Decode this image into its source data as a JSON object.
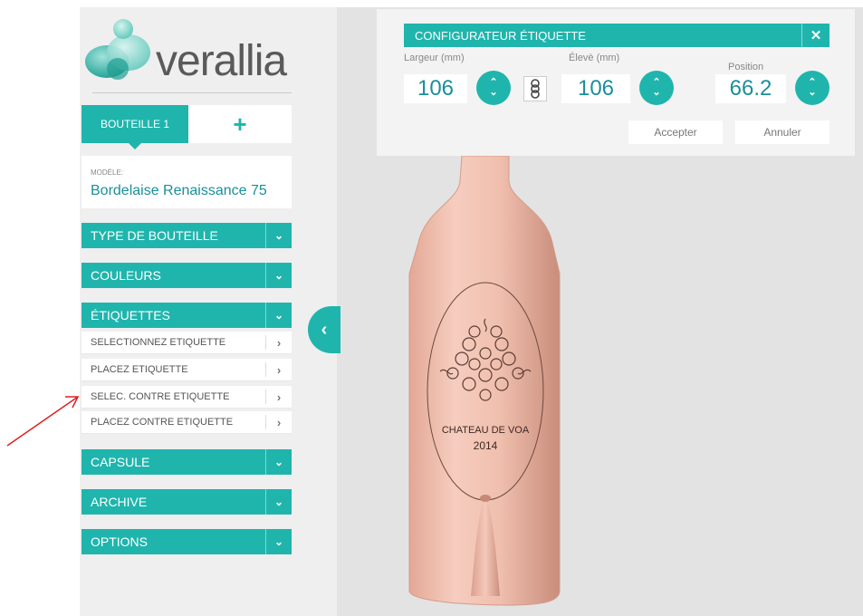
{
  "brand": {
    "name": "verallia"
  },
  "tabs": {
    "active": "BOUTEILLE 1",
    "add": "+"
  },
  "model": {
    "caption": "MODÈLE:",
    "value": "Bordelaise Renaissance 75"
  },
  "menu": {
    "type": "TYPE DE BOUTEILLE",
    "couleurs": "COULEURS",
    "etiquettes": "ÉTIQUETTES",
    "etiquettes_items": [
      "SELECTIONNEZ ETIQUETTE",
      "PLACEZ ETIQUETTE",
      "SELEC. CONTRE ETIQUETTE",
      "PLACEZ CONTRE ETIQUETTE"
    ],
    "capsule": "CAPSULE",
    "archive": "ARCHIVE",
    "options": "OPTIONS"
  },
  "configurator": {
    "title": "CONFIGURATEUR ÉTIQUETTE",
    "close": "✕",
    "largeur_label": "Largeur (mm)",
    "largeur_value": "106",
    "eleve_label": "Élevè (mm)",
    "eleve_value": "106",
    "position_label": "Position",
    "position_value": "66.2",
    "accept": "Accepter",
    "cancel": "Annuler"
  },
  "label": {
    "line1": "CHATEAU DE VOA",
    "line2": "2014"
  },
  "colors": {
    "accent": "#1fb5ad",
    "bottle": "#f0bfae"
  },
  "icons": {
    "collapse": "chevron-left-icon",
    "link": "chain-link-icon",
    "stepper": "up-down-stepper-icon",
    "expand": "chevron-down-icon",
    "item": "chevron-right-icon"
  }
}
